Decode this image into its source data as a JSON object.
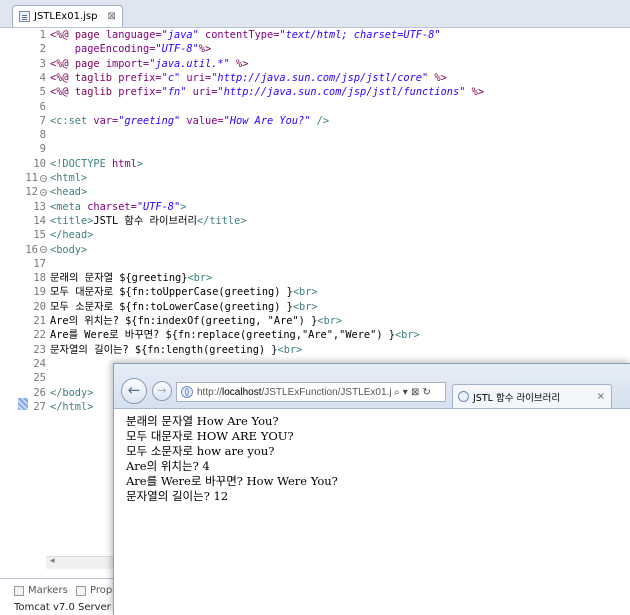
{
  "editor": {
    "tab_label": "JSTLEx01.jsp",
    "tab_close": "⊠",
    "line_numbers": [
      "1",
      "2",
      "3",
      "4",
      "5",
      "6",
      "7",
      "8",
      "9",
      "10",
      "11",
      "12",
      "13",
      "14",
      "15",
      "16",
      "17",
      "18",
      "19",
      "20",
      "21",
      "22",
      "23",
      "24",
      "25",
      "26",
      "27"
    ],
    "code": {
      "l1_open": "<%@ ",
      "l1_page": "page ",
      "l1_lang_attr": "language=",
      "l1_lang_val": "\"java\"",
      "l1_ct_attr": " contentType=",
      "l1_ct_val": "\"text/html; charset=UTF-8\"",
      "l2_pe_attr": "    pageEncoding=",
      "l2_pe_val": "\"UTF-8\"",
      "l2_close": "%>",
      "l3_open": "<%@ ",
      "l3_page": "page ",
      "l3_import_attr": "import=",
      "l3_import_val": "\"java.util.*\"",
      "l3_close": " %>",
      "l4_open": "<%@ ",
      "l4_taglib": "taglib ",
      "l4_prefix_attr": "prefix=",
      "l4_prefix_val": "\"c\"",
      "l4_uri_attr": " uri=",
      "l4_uri_val": "\"http://java.sun.com/jsp/jstl/core\"",
      "l4_close": " %>",
      "l5_open": "<%@ ",
      "l5_taglib": "taglib ",
      "l5_prefix_attr": "prefix=",
      "l5_prefix_val": "\"fn\"",
      "l5_uri_attr": " uri=",
      "l5_uri_val": "\"http://java.sun.com/jsp/jstl/functions\"",
      "l5_close": " %>",
      "l7_tag": "<c:set ",
      "l7_var_attr": "var=",
      "l7_var_val": "\"greeting\"",
      "l7_value_attr": " value=",
      "l7_value_val": "\"How Are You?\"",
      "l7_close": " />",
      "l10_doctype": "<!DOCTYPE ",
      "l10_html": "html",
      "l10_close": ">",
      "l11": "<html>",
      "l12": "<head>",
      "l13_tag": "<meta ",
      "l13_attr": "charset=",
      "l13_val": "\"UTF-8\"",
      "l13_close": ">",
      "l14_open": "<title>",
      "l14_text": "JSTL 함수 라이브러리",
      "l14_close": "</title>",
      "l15": "</head>",
      "l16": "<body>",
      "l18_text": "문래의 문자열 ${greeting}",
      "l18_br": "<br>",
      "l19_text": "모두 대문자로 ${fn:toUpperCase(greeting) }",
      "l19_br": "<br>",
      "l20_text": "모두 소문자로 ${fn:toLowerCase(greeting) }",
      "l20_br": "<br>",
      "l21_text": "Are의 위치는? ${fn:indexOf(greeting, \"Are\") }",
      "l21_br": "<br>",
      "l22_text": "Are를 Were로 바꾸면? ${fn:replace(greeting,\"Are\",\"Were\") }",
      "l22_br": "<br>",
      "l23_text": "문자열의 길이는? ${fn:length(greeting) }",
      "l23_br": "<br>",
      "l26": "</body>",
      "l27": "</html>"
    }
  },
  "bottom_panel": {
    "markers_label": "Markers",
    "properties_label": "Prope",
    "server_label": "Tomcat v7.0 Server at"
  },
  "browser": {
    "back_glyph": "←",
    "forward_glyph": "→",
    "url_prefix": "http://",
    "url_host": "localhost",
    "url_path": "/JSTLExFunction/JSTLEx01.jsp",
    "addr_controls": "⌕ ▾ ⊠ ↻",
    "tab_title": "JSTL 함수 라이브러리",
    "tab_close": "×",
    "output_lines": [
      "분래의 문자열 How Are You?",
      "모두 대문자로 HOW ARE YOU?",
      "모두 소문자로 how are you?",
      "Are의 위치는? 4",
      "Are를 Were로 바꾸면? How Were You?",
      "문자열의 길이는? 12"
    ]
  }
}
